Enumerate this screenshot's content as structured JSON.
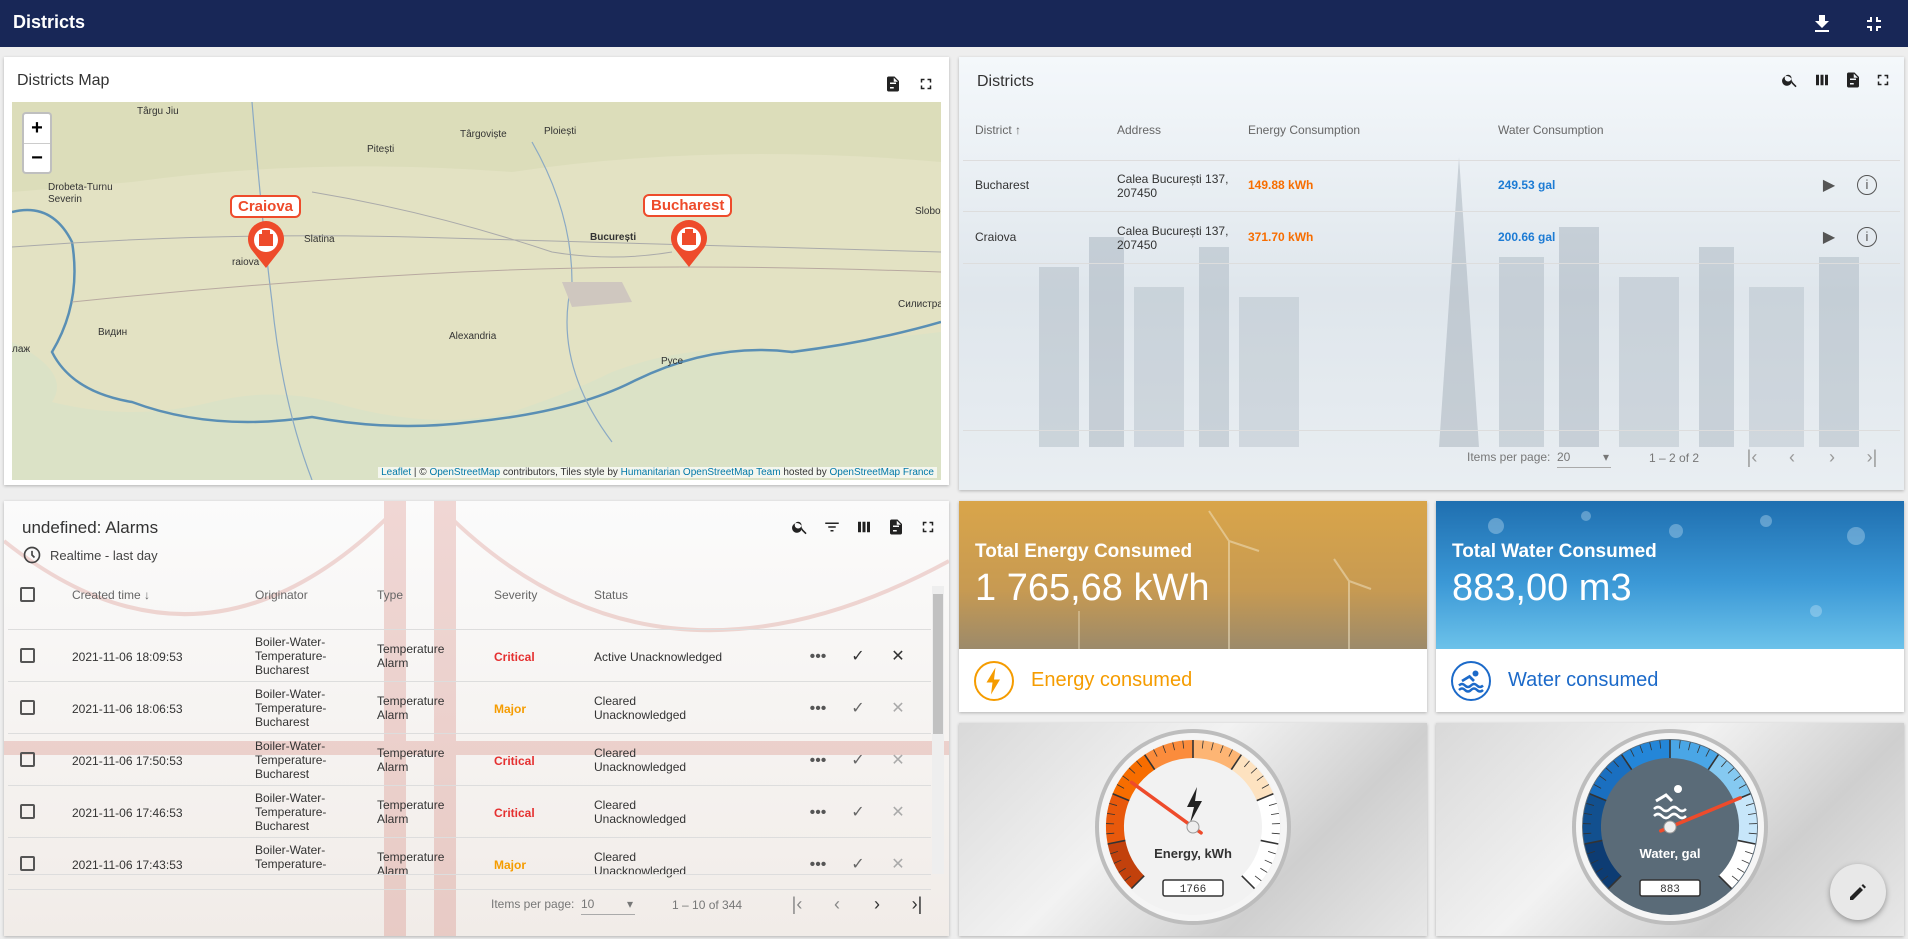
{
  "header": {
    "title": "Districts"
  },
  "map_widget": {
    "title": "Districts Map",
    "zoom_in": "+",
    "zoom_out": "−",
    "markers": {
      "craiova": "Craiova",
      "bucharest": "Bucharest"
    },
    "places": {
      "targu_jiu": "Târgu Jiu",
      "targoviste": "Târgoviște",
      "ploiesti": "Ploiești",
      "pitesti": "Pitești",
      "drobeta": "Drobeta-Turnu",
      "severin": "Severin",
      "slatina": "Slatina",
      "slobo": "Slobo",
      "bucuresti": "București",
      "raiova": "raiova",
      "silistra": "Силистра",
      "vidin": "Видин",
      "alexandria": "Alexandria",
      "ruse": "Русе",
      "edge_label": "лаж"
    },
    "attribution": {
      "leaflet": "Leaflet",
      "sep1": " | © ",
      "osm": "OpenStreetMap",
      "mid": " contributors, Tiles style by ",
      "hot": "Humanitarian OpenStreetMap Team",
      "hosted": " hosted by ",
      "osmfr": "OpenStreetMap France"
    }
  },
  "districts_table": {
    "title": "Districts",
    "columns": {
      "district": "District",
      "address": "Address",
      "energy": "Energy Consumption",
      "water": "Water Consumption"
    },
    "rows": [
      {
        "district": "Bucharest",
        "address_1": "Calea București 137,",
        "address_2": "207450",
        "energy": "149.88 kWh",
        "water": "249.53 gal"
      },
      {
        "district": "Craiova",
        "address_1": "Calea București 137,",
        "address_2": "207450",
        "energy": "371.70 kWh",
        "water": "200.66 gal"
      }
    ],
    "pager": {
      "items_label": "Items per page:",
      "items_value": "20",
      "range": "1 – 2 of 2"
    }
  },
  "alarms": {
    "title": "undefined: Alarms",
    "subtitle": "Realtime - last day",
    "columns": {
      "created": "Created time",
      "originator": "Originator",
      "type": "Type",
      "severity": "Severity",
      "status": "Status"
    },
    "rows": [
      {
        "time": "2021-11-06 18:09:53",
        "orig_1": "Boiler-Water-",
        "orig_2": "Temperature-",
        "orig_3": "Bucharest",
        "type_1": "Temperature",
        "type_2": "Alarm",
        "severity": "Critical",
        "status_1": "Active Unacknowledged",
        "status_2": ""
      },
      {
        "time": "2021-11-06 18:06:53",
        "orig_1": "Boiler-Water-",
        "orig_2": "Temperature-",
        "orig_3": "Bucharest",
        "type_1": "Temperature",
        "type_2": "Alarm",
        "severity": "Major",
        "status_1": "Cleared",
        "status_2": "Unacknowledged"
      },
      {
        "time": "2021-11-06 17:50:53",
        "orig_1": "Boiler-Water-",
        "orig_2": "Temperature-",
        "orig_3": "Bucharest",
        "type_1": "Temperature",
        "type_2": "Alarm",
        "severity": "Critical",
        "status_1": "Cleared",
        "status_2": "Unacknowledged"
      },
      {
        "time": "2021-11-06 17:46:53",
        "orig_1": "Boiler-Water-",
        "orig_2": "Temperature-",
        "orig_3": "Bucharest",
        "type_1": "Temperature",
        "type_2": "Alarm",
        "severity": "Critical",
        "status_1": "Cleared",
        "status_2": "Unacknowledged"
      },
      {
        "time": "2021-11-06 17:43:53",
        "orig_1": "Boiler-Water-",
        "orig_2": "Temperature-",
        "orig_3": "",
        "type_1": "Temperature",
        "type_2": "Alarm",
        "severity": "Major",
        "status_1": "Cleared",
        "status_2": "Unacknowledged"
      }
    ],
    "pager": {
      "items_label": "Items per page:",
      "items_value": "10",
      "range": "1 – 10 of 344"
    }
  },
  "energy_card": {
    "title": "Total Energy Consumed",
    "value": "1 765,68 kWh",
    "label": "Energy consumed",
    "color": "#f59c00"
  },
  "water_card": {
    "title": "Total Water Consumed",
    "value": "883,00 m3",
    "label": "Water consumed",
    "color": "#1c6ac9"
  },
  "energy_gauge": {
    "label": "Energy, kWh",
    "readout": "1766",
    "needle_fraction": 0.3
  },
  "water_gauge": {
    "label": "Water, gal",
    "readout": "883",
    "needle_fraction": 0.75
  }
}
